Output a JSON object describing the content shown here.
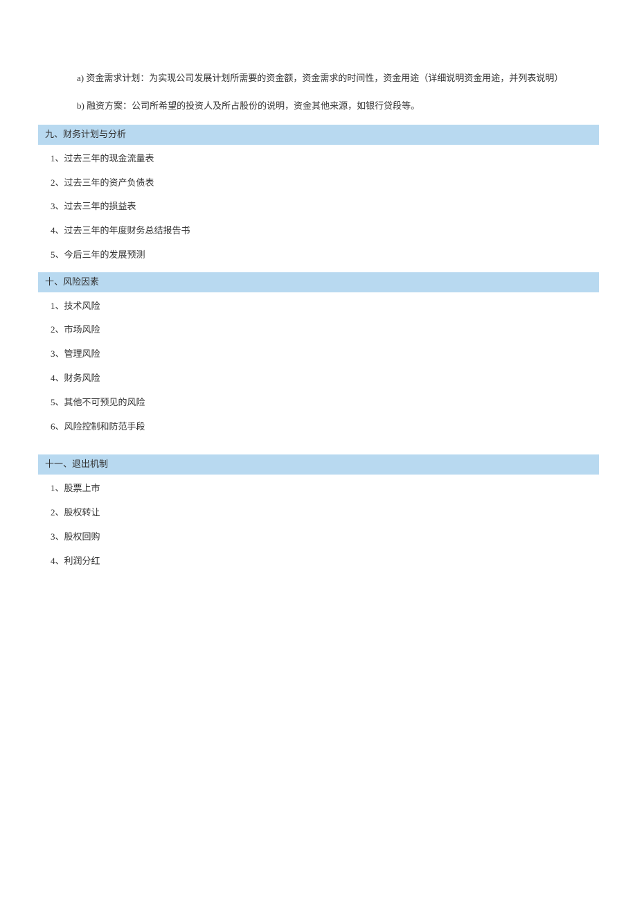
{
  "intro": {
    "line_a": "a) 资金需求计划：为实现公司发展计划所需要的资金额，资金需求的时间性，资金用途（详细说明资金用途，并列表说明）",
    "line_b": "b) 融资方案：公司所希望的投资人及所占股份的说明，资金其他来源，如银行贷段等。"
  },
  "sections": {
    "s9": {
      "title": "九、财务计划与分析",
      "items": [
        "1、过去三年的现金流量表",
        "2、过去三年的资产负债表",
        "3、过去三年的损益表",
        "4、过去三年的年度财务总结报告书",
        "5、今后三年的发展预测"
      ]
    },
    "s10": {
      "title": "十、风险因素",
      "items": [
        "1、技术风险",
        "2、市场风险",
        "3、管理风险",
        "4、财务风险",
        "5、其他不可预见的风险",
        "6、风险控制和防范手段"
      ]
    },
    "s11": {
      "title": "十一、退出机制",
      "items": [
        "1、股票上市",
        "2、股权转让",
        "3、股权回购",
        "4、利润分红"
      ]
    }
  }
}
